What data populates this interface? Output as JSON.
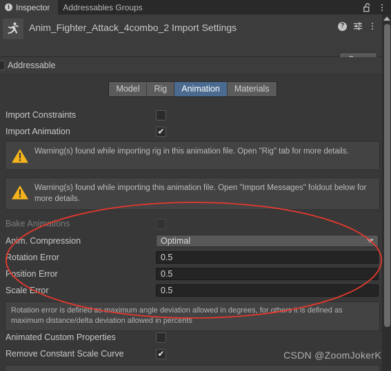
{
  "window": {
    "tabs": [
      {
        "label": "Inspector",
        "icon": "info-icon",
        "active": true
      },
      {
        "label": "Addressables Groups",
        "icon": "",
        "active": false
      }
    ],
    "lock_icon": "lock-open-icon",
    "menu_icon": "kebab-menu-icon"
  },
  "header": {
    "asset_icon": "animation-clip-icon",
    "title": "Anim_Fighter_Attack_4combo_2 Import Settings",
    "help_icon": "help-icon",
    "preset_icon": "preset-settings-icon",
    "menu_icon": "kebab-menu-icon",
    "open_label": "Open"
  },
  "addressable": {
    "label": "Addressable",
    "checked": false
  },
  "tabs": {
    "items": [
      {
        "label": "Model",
        "selected": false
      },
      {
        "label": "Rig",
        "selected": false
      },
      {
        "label": "Animation",
        "selected": true
      },
      {
        "label": "Materials",
        "selected": false
      }
    ],
    "selected_color": "#4a6b8f"
  },
  "properties": {
    "import_constraints": {
      "label": "Import Constraints",
      "checked": false,
      "disabled": false
    },
    "import_animation": {
      "label": "Import Animation",
      "checked": true,
      "disabled": false
    },
    "bake_animations": {
      "label": "Bake Animations",
      "checked": false,
      "disabled": true
    },
    "anim_compression": {
      "label": "Anim. Compression",
      "value": "Optimal"
    },
    "rotation_error": {
      "label": "Rotation Error",
      "value": "0.5"
    },
    "position_error": {
      "label": "Position Error",
      "value": "0.5"
    },
    "scale_error": {
      "label": "Scale Error",
      "value": "0.5"
    },
    "animated_custom_properties": {
      "label": "Animated Custom Properties",
      "checked": false
    },
    "remove_constant_scale_curves": {
      "label": "Remove Constant Scale Curve",
      "checked": true
    }
  },
  "warnings": [
    {
      "icon": "warning-icon",
      "text": "Warning(s) found while importing rig in this animation file. Open \"Rig\" tab for more details.",
      "color": "#f5b31b"
    },
    {
      "icon": "warning-icon",
      "text": "Warning(s) found while importing this animation file. Open \"Import Messages\" foldout below for more details.",
      "color": "#f5b31b"
    }
  ],
  "info_box": {
    "text": "Rotation error is defined as maximum angle deviation allowed in degrees, for others it is defined as maximum distance/delta deviation allowed in percents"
  },
  "annotation": {
    "shape": "ellipse",
    "color": "#e8392e"
  },
  "watermark": {
    "text": "CSDN @ZoomJokerK"
  },
  "scrollbar": {
    "name": "vertical-scrollbar"
  }
}
